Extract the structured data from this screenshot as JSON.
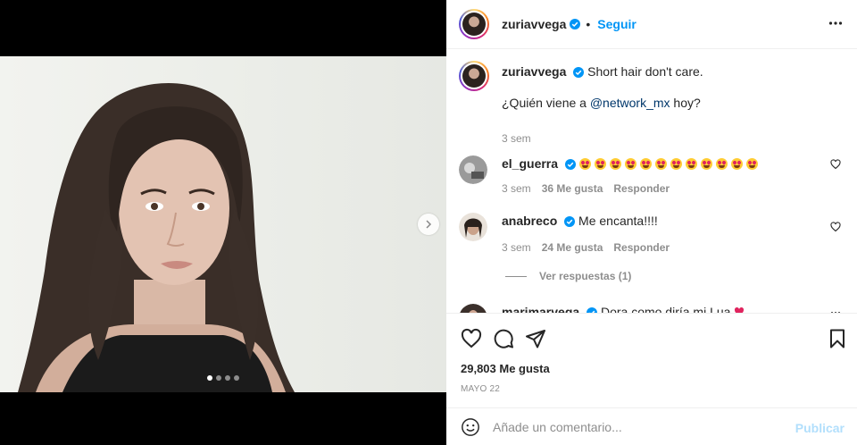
{
  "post": {
    "author": "zuriavvega",
    "follow_label": "Seguir",
    "separator": "•",
    "caption_line1": "Short hair don't care.",
    "caption_line2_prefix": "¿Quién viene a ",
    "caption_mention": "@network_mx",
    "caption_line2_suffix": " hoy?",
    "caption_time": "3 sem",
    "likes": "29,803 Me gusta",
    "date": "MAYO 22"
  },
  "carousel": {
    "total": 4,
    "active": 0
  },
  "comments": [
    {
      "user": "el_guerra",
      "emoji_count": 12,
      "time": "3 sem",
      "likes": "36 Me gusta",
      "reply": "Responder"
    },
    {
      "user": "anabreco",
      "text": "Me encanta!!!!",
      "time": "3 sem",
      "likes": "24 Me gusta",
      "reply": "Responder",
      "view_replies": "Ver respuestas (1)"
    },
    {
      "user": "marimarvega",
      "text": "Dora como diría mi Lua"
    }
  ],
  "composer": {
    "placeholder": "Añade un comentario...",
    "post_label": "Publicar"
  },
  "colors": {
    "accent": "#0095f6",
    "verified": "#0095f6",
    "muted": "#8e8e8e"
  }
}
